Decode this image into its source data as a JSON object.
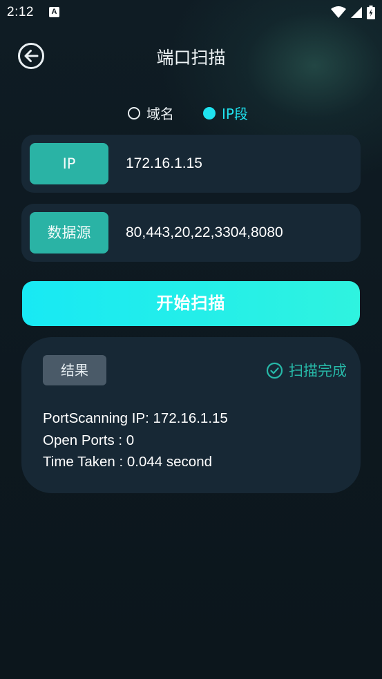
{
  "status_bar": {
    "time": "2:12",
    "notification_icon_letter": "A"
  },
  "header": {
    "title": "端口扫描",
    "back_icon": "back-arrow-circle-icon"
  },
  "mode_options": [
    {
      "label": "域名",
      "selected": false
    },
    {
      "label": "IP段",
      "selected": true
    }
  ],
  "fields": {
    "ip": {
      "tag": "IP",
      "value": "172.16.1.15"
    },
    "source": {
      "tag": "数据源",
      "value": "80,443,20,22,3304,8080"
    }
  },
  "start_button": {
    "label": "开始扫描"
  },
  "result": {
    "tag": "结果",
    "status": "扫描完成",
    "lines": [
      "PortScanning IP: 172.16.1.15",
      "Open Ports : 0",
      "Time Taken : 0.044 second"
    ]
  },
  "colors": {
    "accent_cyan": "#1fe3f0",
    "tag_teal": "#2ab3a5",
    "card_bg": "#172835",
    "page_bg": "#0d181f",
    "status_green": "#27b9a8"
  }
}
